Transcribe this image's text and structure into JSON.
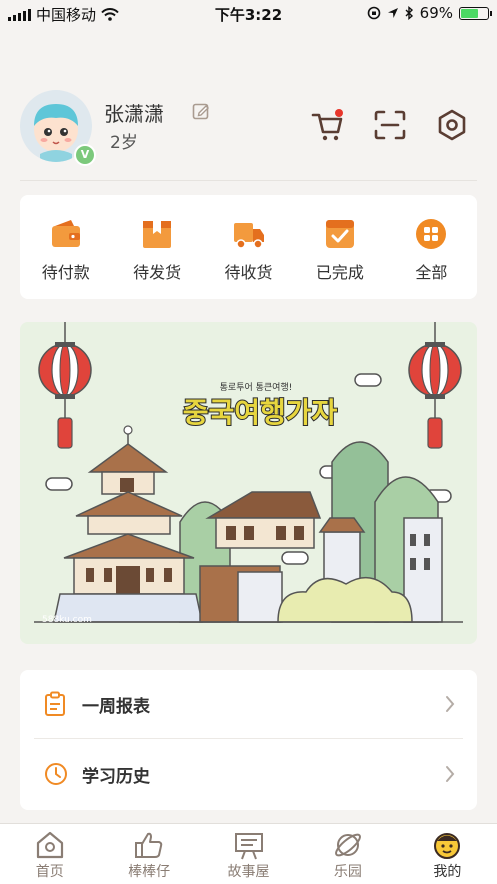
{
  "status_bar": {
    "carrier": "中国移动",
    "time": "下午3:22",
    "battery": "69%",
    "battery_level": 0.69
  },
  "profile": {
    "name": "张潇潇",
    "age": "2岁",
    "badge": "V"
  },
  "orders": [
    {
      "label": "待付款",
      "icon": "wallet-icon"
    },
    {
      "label": "待发货",
      "icon": "package-icon"
    },
    {
      "label": "待收货",
      "icon": "delivery-truck-icon"
    },
    {
      "label": "已完成",
      "icon": "checkbox-icon"
    },
    {
      "label": "全部",
      "icon": "grid-icon"
    }
  ],
  "banner": {
    "subtitle": "통로투어 통큰여행!",
    "title": "중국여행가자",
    "watermark": "588ku.com"
  },
  "menu": [
    {
      "label": "一周报表",
      "icon": "clipboard-icon"
    },
    {
      "label": "学习历史",
      "icon": "clock-icon"
    }
  ],
  "tabs": [
    {
      "label": "首页",
      "icon": "home-icon"
    },
    {
      "label": "棒棒仔",
      "icon": "thumbs-up-icon"
    },
    {
      "label": "故事屋",
      "icon": "easel-icon"
    },
    {
      "label": "乐园",
      "icon": "planet-icon"
    },
    {
      "label": "我的",
      "icon": "kid-face-icon",
      "active": true
    }
  ],
  "colors": {
    "accent": "#f08a24",
    "dot": "#e8362b",
    "badge": "#7cc97c"
  }
}
